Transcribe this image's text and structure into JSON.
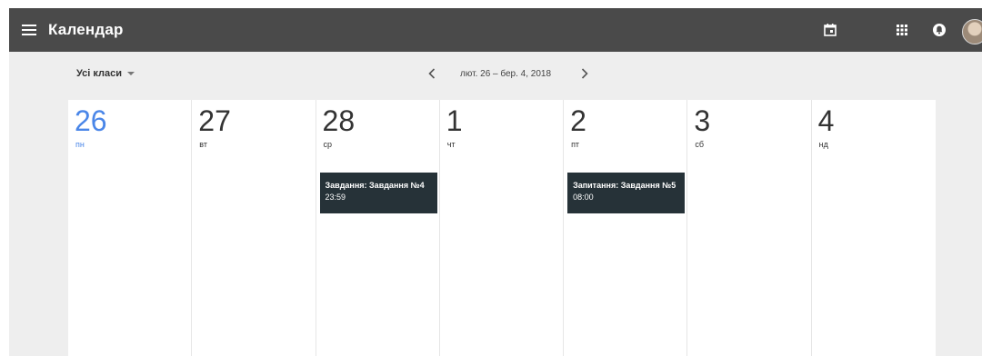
{
  "app": {
    "title": "Календар"
  },
  "toolbar": {
    "icons": [
      "menu-icon",
      "calendar-icon",
      "apps-grid-icon",
      "notifications-icon",
      "avatar"
    ]
  },
  "filter": {
    "selected": "Усі класи"
  },
  "range": {
    "label": "лют. 26 – бер. 4, 2018"
  },
  "days": [
    {
      "num": "26",
      "name": "пн",
      "today": true
    },
    {
      "num": "27",
      "name": "вт"
    },
    {
      "num": "28",
      "name": "ср"
    },
    {
      "num": "1",
      "name": "чт"
    },
    {
      "num": "2",
      "name": "пт"
    },
    {
      "num": "3",
      "name": "сб"
    },
    {
      "num": "4",
      "name": "нд"
    }
  ],
  "events": {
    "wed": {
      "title": "Завдання: Завдання №4",
      "time": "23:59"
    },
    "fri": {
      "title": "Запитання: Завдання №5",
      "time": "08:00"
    }
  },
  "colors": {
    "topbar": "#4a4a4a",
    "background": "#eeeeee",
    "today": "#4a86e8",
    "event": "#263238"
  }
}
